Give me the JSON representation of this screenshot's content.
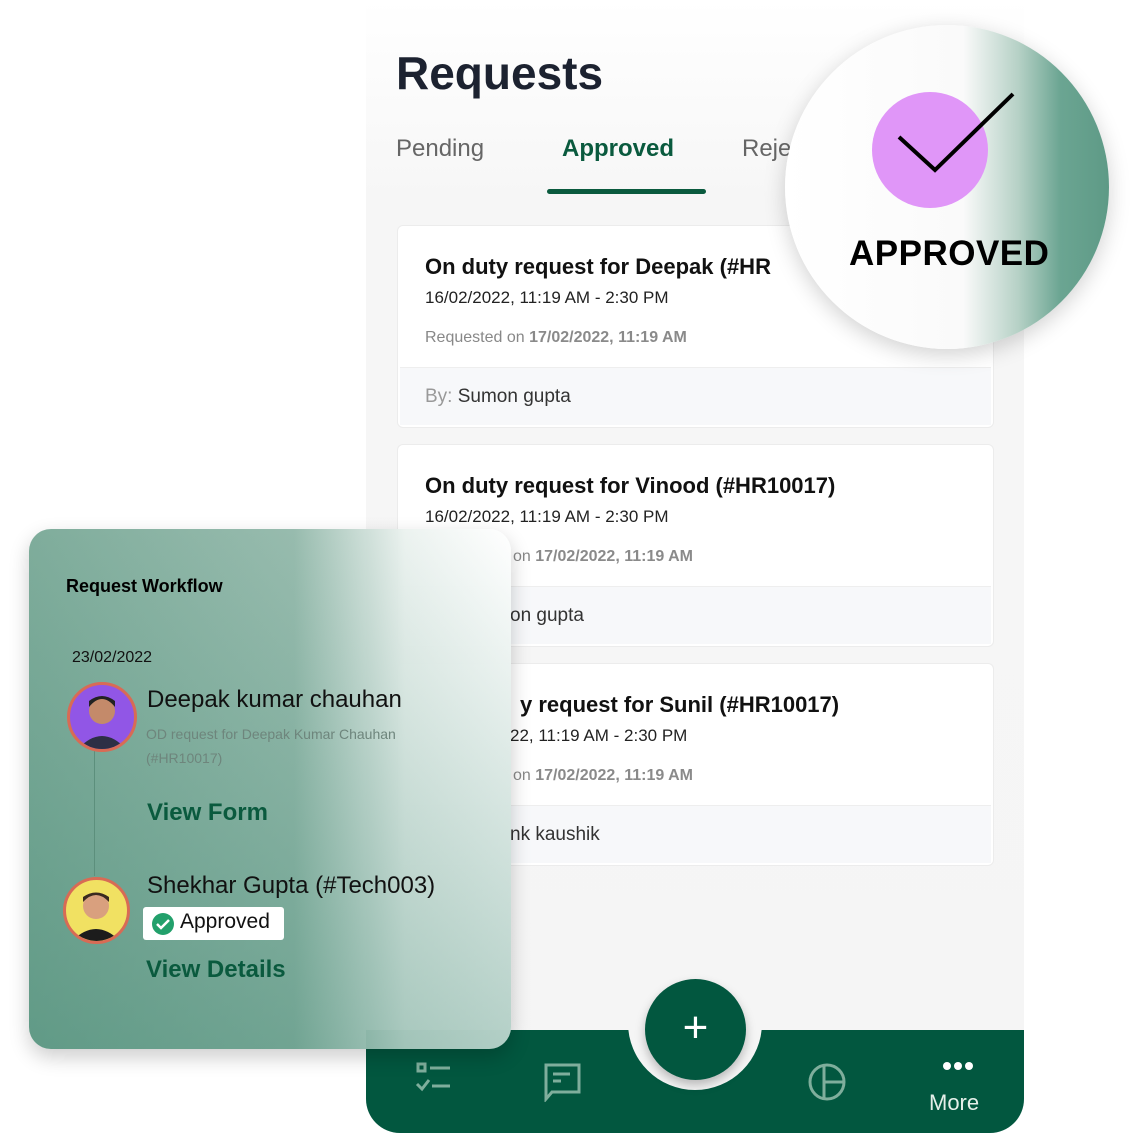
{
  "header": {
    "title": "Requests"
  },
  "tabs": [
    {
      "label": "Pending"
    },
    {
      "label": "Approved",
      "active": true
    },
    {
      "label": "Reje"
    }
  ],
  "requests": [
    {
      "title": "On duty request for Deepak (#HR",
      "date": "16/02/2022, 11:19 AM - 2:30 PM",
      "requested_prefix": "Requested on",
      "requested_on": "17/02/2022, 11:19 AM",
      "by_label": "By:",
      "by": "Sumon gupta"
    },
    {
      "title": "On duty request for Vinood (#HR10017)",
      "date": "16/02/2022, 11:19 AM - 2:30 PM",
      "requested_prefix": "on",
      "requested_on": "17/02/2022, 11:19 AM",
      "by_label": "",
      "by": "on gupta"
    },
    {
      "title": "y request for Sunil (#HR10017)",
      "date": "22, 11:19 AM - 2:30 PM",
      "requested_prefix": "on",
      "requested_on": "17/02/2022, 11:19 AM",
      "by_label": "",
      "by": "nk kaushik"
    }
  ],
  "approved_badge": {
    "label": "APPROVED",
    "circle_color": "#e096f8"
  },
  "workflow": {
    "title": "Request Workflow",
    "date": "23/02/2022",
    "steps": [
      {
        "name": "Deepak kumar chauhan",
        "desc": "OD request for Deepak Kumar Chauhan (#HR10017)",
        "action": "View Form"
      },
      {
        "name": "Shekhar Gupta (#Tech003)",
        "status": "Approved",
        "action": "View Details"
      }
    ]
  },
  "bottom_nav": {
    "items": [
      {
        "icon": "checklist-icon"
      },
      {
        "icon": "message-icon"
      },
      {
        "icon": "add-icon",
        "label": "+"
      },
      {
        "icon": "pie-chart-icon"
      },
      {
        "icon": "more-icon",
        "label": "More"
      }
    ]
  },
  "colors": {
    "brand": "#02573f",
    "accent": "#0a5a3e"
  }
}
